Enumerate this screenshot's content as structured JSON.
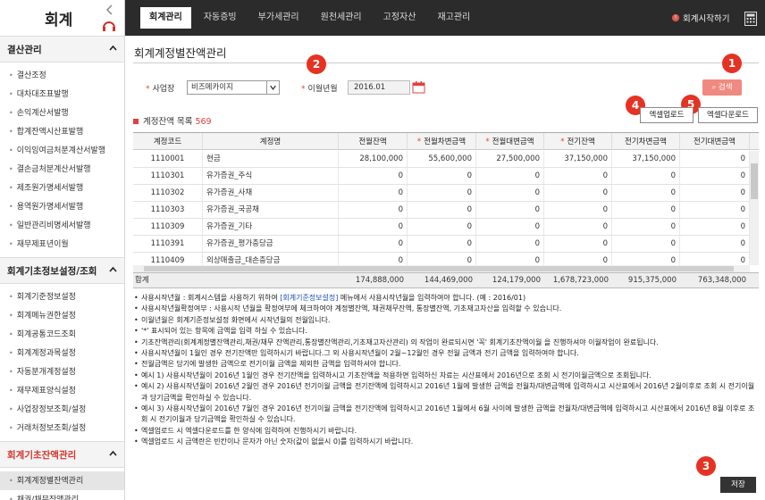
{
  "app": {
    "logo": "회계"
  },
  "nav": [
    {
      "label": "회계관리",
      "active": true
    },
    {
      "label": "자동증빙",
      "active": false
    },
    {
      "label": "부가세관리",
      "active": false
    },
    {
      "label": "원천세관리",
      "active": false
    },
    {
      "label": "고정자산",
      "active": false
    },
    {
      "label": "재고관리",
      "active": false
    }
  ],
  "top_right": {
    "start_label": "회계시작하기"
  },
  "sidebar": [
    {
      "title": "결산관리",
      "red": false,
      "items": [
        "결산조정",
        "대차대조표발행",
        "손익계산서발행",
        "합계잔액시산표발행",
        "이익잉여금처분계산서발행",
        "결손금처분계산서발행",
        "제조원가명세서발행",
        "용역원가명세서발행",
        "일반관리비명세서발행",
        "재무제표년이월"
      ]
    },
    {
      "title": "회계기초정보설정/조회",
      "red": false,
      "items": [
        "회계기준정보설정",
        "회계메뉴권한설정",
        "회계공통코드조회",
        "회계계정과목설정",
        "자동분개계정설정",
        "재무제표양식설정",
        "사업장정보조회/설정",
        "거래처정보조회/설정"
      ]
    },
    {
      "title": "회계기초잔액관리",
      "red": true,
      "items": [
        "회계계정별잔액관리",
        "채권/채무잔액관리"
      ],
      "selected": 0
    }
  ],
  "page": {
    "title": "회계계정별잔액관리"
  },
  "filter": {
    "workplace_label": "사업장",
    "workplace_value": "비즈메카이지",
    "month_label": "이월년월",
    "month_value": "2016.01",
    "search_label": "검색"
  },
  "badges": [
    "1",
    "2",
    "3",
    "4",
    "5"
  ],
  "list": {
    "title": "계정잔액 목록",
    "count": "569"
  },
  "buttons": {
    "excel_upload": "엑셀업로드",
    "excel_download": "엑셀다운로드",
    "save": "저장"
  },
  "table": {
    "columns": [
      {
        "label": "계정코드",
        "req": false
      },
      {
        "label": "계정명",
        "req": false
      },
      {
        "label": "전월잔액",
        "req": false
      },
      {
        "label": "전월차변금액",
        "req": true
      },
      {
        "label": "전월대변금액",
        "req": true
      },
      {
        "label": "전기잔액",
        "req": true
      },
      {
        "label": "전기차변금액",
        "req": false
      },
      {
        "label": "전기대변금액",
        "req": false
      }
    ],
    "rows": [
      [
        "1110001",
        "현금",
        "28,100,000",
        "55,600,000",
        "27,500,000",
        "37,150,000",
        "37,150,000",
        "0"
      ],
      [
        "1110301",
        "유가증권_주식",
        "0",
        "0",
        "0",
        "0",
        "0",
        "0"
      ],
      [
        "1110302",
        "유가증권_사채",
        "0",
        "0",
        "0",
        "0",
        "0",
        "0"
      ],
      [
        "1110303",
        "유가증권_국공채",
        "0",
        "0",
        "0",
        "0",
        "0",
        "0"
      ],
      [
        "1110309",
        "유가증권_기타",
        "0",
        "0",
        "0",
        "0",
        "0",
        "0"
      ],
      [
        "1110391",
        "유가증권_평가충당금",
        "0",
        "0",
        "0",
        "0",
        "0",
        "0"
      ],
      [
        "1110409",
        "외상매출금_대손충당금",
        "0",
        "0",
        "0",
        "0",
        "0",
        "0"
      ]
    ],
    "total": [
      "합계",
      "",
      "174,888,000",
      "144,469,000",
      "124,179,000",
      "1,678,723,000",
      "915,375,000",
      "763,348,000"
    ]
  },
  "notes": [
    {
      "pre": "사용시작년월 : 회계시스템을 사용하기 위하여 ",
      "link": "[회계기준정보설정]",
      "post": " 메뉴에서 사용시작년월을 입력하여야 합니다. (예 : 2016/01)"
    },
    {
      "pre": "사용시작년월확정여부 : 사용시작 년월을 확정여부에 체크하여야 계정별잔액, 채권채무잔액, 통장별잔액, 기초재고자산을 입력할 수 있습니다.",
      "link": "",
      "post": ""
    },
    {
      "pre": "이월년월은 회계기준정보설정 화면에서 시작년월의 전월입니다.",
      "link": "",
      "post": ""
    },
    {
      "pre": "'*' 표시되어 있는 항목에 금액을 입력 하실 수 있습니다.",
      "link": "",
      "post": ""
    },
    {
      "pre": "기초잔액관리(회계계정별잔액관리,채권/채무 잔액관리,통장별잔액관리,기초재고자산관리) 의 작업이 완료되시면 '꼭' 회계기초잔액이월 을 진행하셔야 이월작업이 완료됩니다.",
      "link": "",
      "post": ""
    },
    {
      "pre": "사용시작년월이 1월인 경우 전기잔액만 입력하시기 바랍니다.그 외 사용시작년월이 2월~12월인 경우 전월 금액과 전기 금액을 입력하여야 합니다.",
      "link": "",
      "post": ""
    },
    {
      "pre": "전월금액은 당기에 발생한 금액으로 전기이월 금액을 제외한 금액을 입력하셔야 합니다.",
      "link": "",
      "post": ""
    },
    {
      "pre": "예시 1) 사용시작년월이 2016년 1월인 경우 전기잔액을 입력하시고 기초잔액을 적용하면 입력하신 자료는 시산표에서 2016년으로 조회 시 전기이월금액으로 조회됩니다.",
      "link": "",
      "post": ""
    },
    {
      "pre": "예시 2) 사용시작년월이 2016년 2월인 경우 2016년 전기이월 금액을 전기잔액에 입력하시고 2016년 1월에 발생한 금액을 전월차/대변금액에 입력하시고 시산표에서 2016년 2월이후로 조회 시 전기이월과 당기금액을 확인하실 수 있습니다.",
      "link": "",
      "post": ""
    },
    {
      "pre": "예시 3) 사용시작년월이 2016년 7월인 경우 2016년 전기이월 금액을 전기잔액에 입력하시고 2016년 1월에서 6월 사이에 발생한 금액을 전월차/대변금액에 입력하시고 시산표에서 2016년 8월 이후로 조회 시 전기이월과 당기금액을 확인하실 수 있습니다.",
      "link": "",
      "post": ""
    },
    {
      "pre": "엑셀업로드 시 엑셀다운로드를 한 양식에 입력하여 진행하시기 바랍니다.",
      "link": "",
      "post": ""
    },
    {
      "pre": "엑셀업로드 시 금액란은 빈칸이나 문자가 아닌 숫자(값이 없을시 0)를 입력하시기 바랍니다.",
      "link": "",
      "post": ""
    }
  ],
  "colors": {
    "accent": "#e63222",
    "search": "#f08a80",
    "topbar": "#2b2b2b"
  }
}
